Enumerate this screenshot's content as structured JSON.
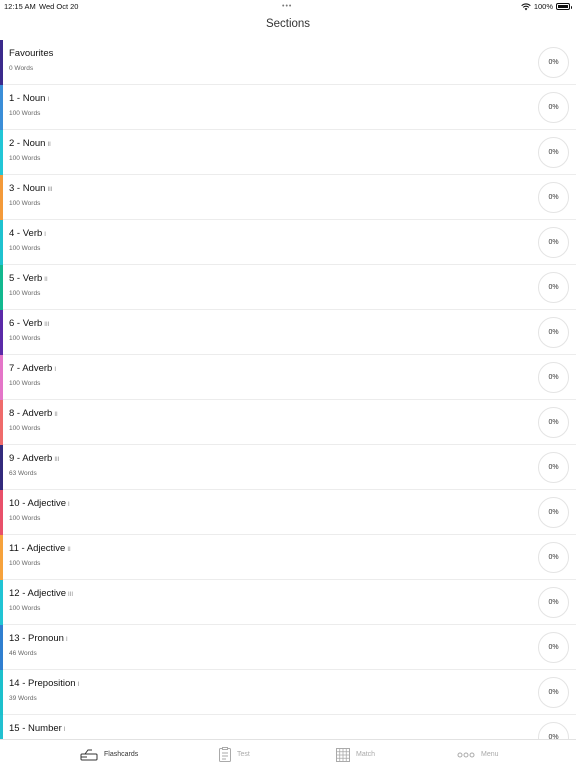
{
  "status": {
    "time": "12:15 AM",
    "date": "Wed Oct 20",
    "battery": "100%"
  },
  "header": {
    "title": "Sections"
  },
  "sections": [
    {
      "title": "Favourites",
      "roman": "",
      "count": "0 Words",
      "progress": "0%",
      "color": "#3b2a8c"
    },
    {
      "title": "1 - Noun",
      "roman": "I",
      "count": "100 Words",
      "progress": "0%",
      "color": "#3a8ed8"
    },
    {
      "title": "2 - Noun",
      "roman": "II",
      "count": "100 Words",
      "progress": "0%",
      "color": "#22c6d6"
    },
    {
      "title": "3 - Noun",
      "roman": "III",
      "count": "100 Words",
      "progress": "0%",
      "color": "#f39a3a"
    },
    {
      "title": "4 - Verb",
      "roman": "I",
      "count": "100 Words",
      "progress": "0%",
      "color": "#1fc2cf"
    },
    {
      "title": "5 - Verb",
      "roman": "II",
      "count": "100 Words",
      "progress": "0%",
      "color": "#12b88f"
    },
    {
      "title": "6 - Verb",
      "roman": "III",
      "count": "100 Words",
      "progress": "0%",
      "color": "#5b2aa8"
    },
    {
      "title": "7 - Adverb",
      "roman": "I",
      "count": "100 Words",
      "progress": "0%",
      "color": "#e475c8"
    },
    {
      "title": "8 - Adverb",
      "roman": "II",
      "count": "100 Words",
      "progress": "0%",
      "color": "#ef6b6b"
    },
    {
      "title": "9 - Adverb",
      "roman": "III",
      "count": "63 Words",
      "progress": "0%",
      "color": "#332a7c"
    },
    {
      "title": "10 - Adjective",
      "roman": "I",
      "count": "100 Words",
      "progress": "0%",
      "color": "#e8506a"
    },
    {
      "title": "11 - Adjective",
      "roman": "II",
      "count": "100 Words",
      "progress": "0%",
      "color": "#f6a23c"
    },
    {
      "title": "12 - Adjective",
      "roman": "III",
      "count": "100 Words",
      "progress": "0%",
      "color": "#21c4d4"
    },
    {
      "title": "13 - Pronoun",
      "roman": "I",
      "count": "46 Words",
      "progress": "0%",
      "color": "#2f7fd0"
    },
    {
      "title": "14 - Preposition",
      "roman": "I",
      "count": "39 Words",
      "progress": "0%",
      "color": "#1cc0cc"
    },
    {
      "title": "15 - Number",
      "roman": "I",
      "count": "",
      "progress": "0%",
      "color": "#22c0d0"
    }
  ],
  "tabs": [
    {
      "label": "Flashcards",
      "icon": "flashcards-icon",
      "active": true
    },
    {
      "label": "Test",
      "icon": "test-icon",
      "active": false
    },
    {
      "label": "Match",
      "icon": "match-grid-icon",
      "active": false
    },
    {
      "label": "Menu",
      "icon": "menu-dots-icon",
      "active": false
    }
  ]
}
